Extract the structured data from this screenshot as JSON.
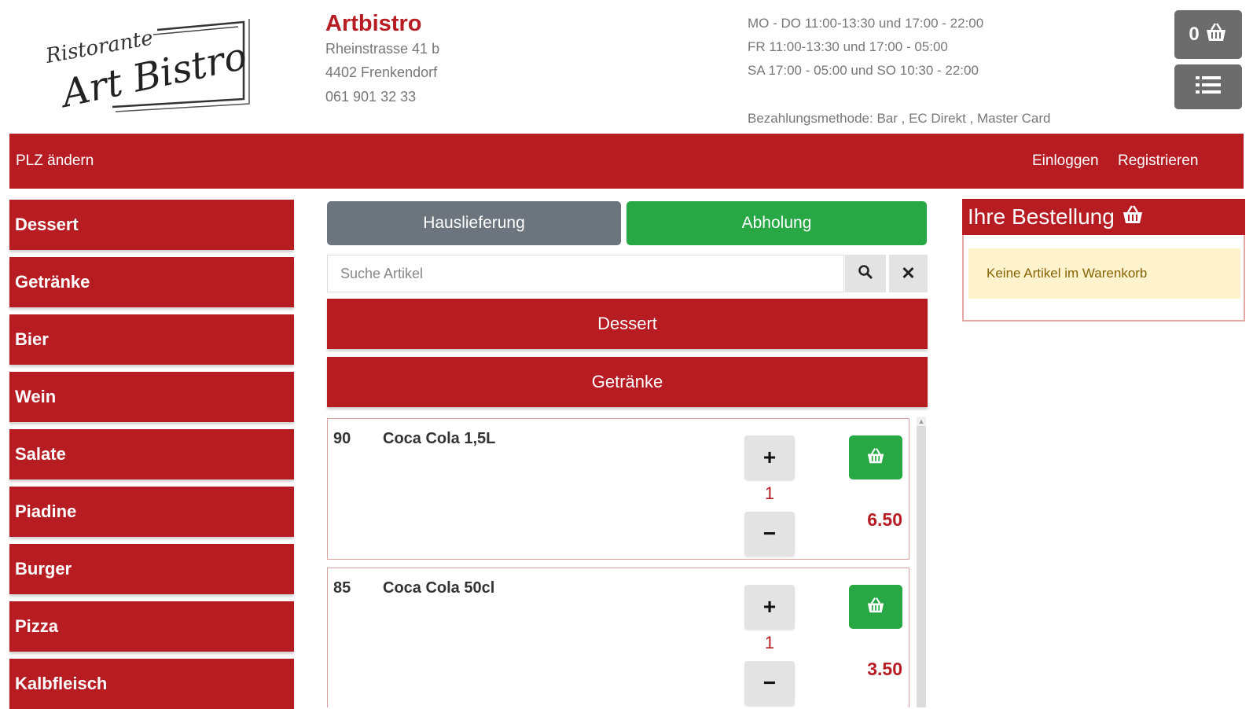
{
  "header": {
    "restaurant_name": "Artbistro",
    "address_line1": "Rheinstrasse 41 b",
    "address_line2": "4402 Frenkendorf",
    "phone": "061 901 32 33",
    "hours": [
      "MO - DO 11:00-13:30 und 17:00 - 22:00",
      "FR 11:00-13:30 und 17:00 - 05:00",
      "SA 17:00 - 05:00 und SO 10:30 - 22:00"
    ],
    "payment": "Bezahlungsmethode: Bar , EC Direkt , Master Card",
    "cart_count": "0"
  },
  "navbar": {
    "plz_label": "PLZ ändern",
    "login_label": "Einloggen",
    "register_label": "Registrieren"
  },
  "sidebar": {
    "items": [
      {
        "label": "Dessert"
      },
      {
        "label": "Getränke"
      },
      {
        "label": "Bier"
      },
      {
        "label": "Wein"
      },
      {
        "label": "Salate"
      },
      {
        "label": "Piadine"
      },
      {
        "label": "Burger"
      },
      {
        "label": "Pizza"
      },
      {
        "label": "Kalbfleisch"
      }
    ]
  },
  "tabs": {
    "delivery": "Hauslieferung",
    "pickup": "Abholung"
  },
  "search": {
    "placeholder": "Suche Artikel",
    "value": ""
  },
  "categories": [
    "Dessert",
    "Getränke"
  ],
  "products": [
    {
      "number": "90",
      "name": "Coca Cola 1,5L",
      "qty": "1",
      "price": "6.50"
    },
    {
      "number": "85",
      "name": "Coca Cola 50cl",
      "qty": "1",
      "price": "3.50"
    }
  ],
  "order": {
    "title": "Ihre Bestellung",
    "empty_text": "Keine Artikel im Warenkorb"
  },
  "colors": {
    "brand_red": "#b61c22",
    "pickup_green": "#28a745",
    "delivery_gray": "#6c757d",
    "empty_cart_bg": "#fff3cd"
  }
}
